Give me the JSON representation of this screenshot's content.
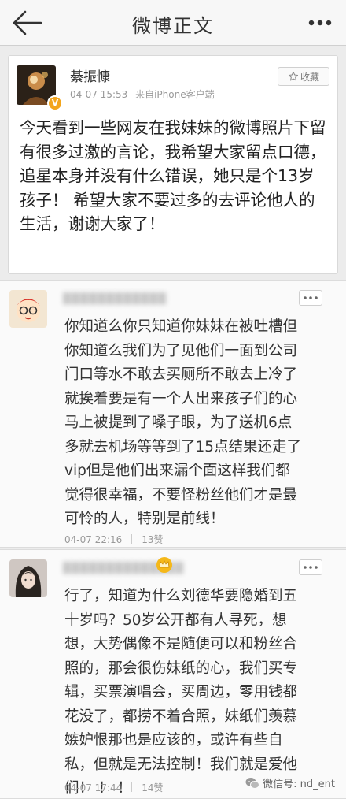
{
  "nav": {
    "title": "微博正文",
    "back_icon": "back-arrow-icon",
    "more_icon": "more-dots-icon"
  },
  "post": {
    "author": "綦振慷",
    "time": "04-07 15:53",
    "source": "来自iPhone客户端",
    "fav_label": "收藏",
    "fav_icon": "star-icon",
    "verified_icon": "v-badge-icon",
    "text": "今天看到一些网友在我妹妹的微博照片下留有很多过激的言论，我希望大家留点口德，追星本身并没有什么错误，她只是个13岁孩子！ 希望大家不要过多的去评论他人的生活，谢谢大家了！"
  },
  "comments": [
    {
      "text": "你知道么你只知道你妹妹在被吐槽但你知道么我们为了见他们一面到公司门口等水不敢去买厕所不敢去上冷了就挨着要是有一个人出来孩子们的心马上被提到了嗓子眼，为了送机6点多就去机场等等到了15点结果还走了vip但是他们出来漏个面这样我们都觉得很幸福，不要怪粉丝他们才是最可怜的人，特别是前线！",
      "time": "04-07 22:16",
      "likes": "13赞"
    },
    {
      "text": "行了，知道为什么刘德华要隐婚到五十岁吗？50岁公开都有人寻死，想想，大势偶像不是随便可以和粉丝合照的，那会很伤妹纸的心，我们买专辑，买票演唱会，买周边，零用钱都花没了，都捞不着合照，妹纸们羡慕嫉妒恨那也是应该的，或许有些自私，但就是无法控制！我们就是爱他们！ ！ ！",
      "time": "04-07 17:44",
      "likes": "14赞"
    }
  ],
  "watermark": "微信号: nd_ent",
  "colors": {
    "accent": "#f3a51c",
    "background": "#ececec"
  }
}
